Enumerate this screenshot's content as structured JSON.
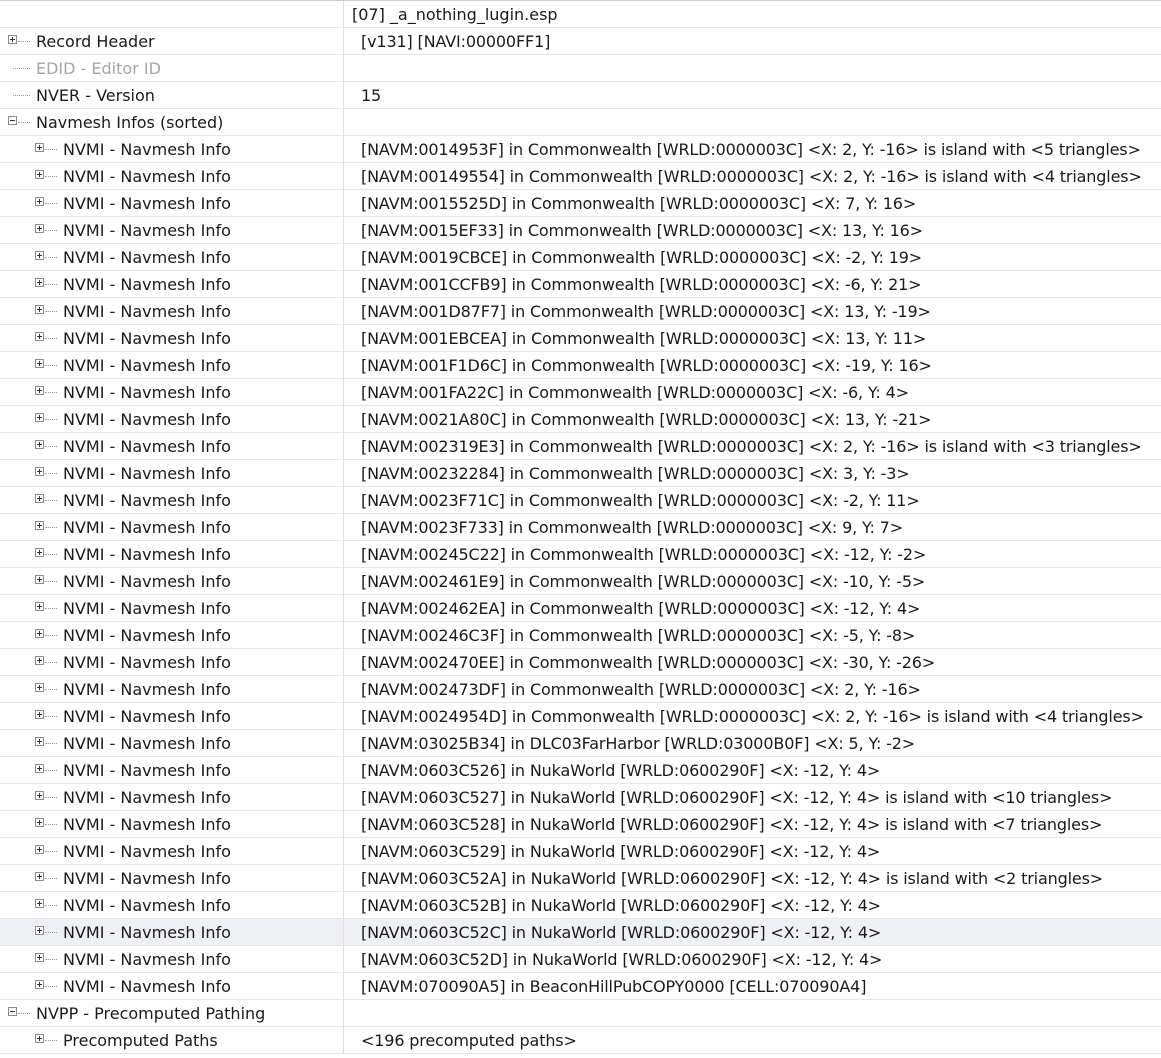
{
  "file_header": "[07] _a_nothing_lugin.esp",
  "record_header": {
    "label": "Record Header",
    "value": "[v131] [NAVI:00000FF1]"
  },
  "edid": {
    "label": "EDID - Editor ID",
    "value": ""
  },
  "nver": {
    "label": "NVER - Version",
    "value": "15"
  },
  "navmesh_infos": {
    "label": "Navmesh Infos (sorted)",
    "item_label": "NVMI - Navmesh Info",
    "items": [
      "[NAVM:0014953F] in Commonwealth [WRLD:0000003C] <X: 2, Y: -16> is island with <5 triangles>",
      "[NAVM:00149554] in Commonwealth [WRLD:0000003C] <X: 2, Y: -16> is island with <4 triangles>",
      "[NAVM:0015525D] in Commonwealth [WRLD:0000003C] <X: 7, Y: 16>",
      "[NAVM:0015EF33] in Commonwealth [WRLD:0000003C] <X: 13, Y: 16>",
      "[NAVM:0019CBCE] in Commonwealth [WRLD:0000003C] <X: -2, Y: 19>",
      "[NAVM:001CCFB9] in Commonwealth [WRLD:0000003C] <X: -6, Y: 21>",
      "[NAVM:001D87F7] in Commonwealth [WRLD:0000003C] <X: 13, Y: -19>",
      "[NAVM:001EBCEA] in Commonwealth [WRLD:0000003C] <X: 13, Y: 11>",
      "[NAVM:001F1D6C] in Commonwealth [WRLD:0000003C] <X: -19, Y: 16>",
      "[NAVM:001FA22C] in Commonwealth [WRLD:0000003C] <X: -6, Y: 4>",
      "[NAVM:0021A80C] in Commonwealth [WRLD:0000003C] <X: 13, Y: -21>",
      "[NAVM:002319E3] in Commonwealth [WRLD:0000003C] <X: 2, Y: -16> is island with <3 triangles>",
      "[NAVM:00232284] in Commonwealth [WRLD:0000003C] <X: 3, Y: -3>",
      "[NAVM:0023F71C] in Commonwealth [WRLD:0000003C] <X: -2, Y: 11>",
      "[NAVM:0023F733] in Commonwealth [WRLD:0000003C] <X: 9, Y: 7>",
      "[NAVM:00245C22] in Commonwealth [WRLD:0000003C] <X: -12, Y: -2>",
      "[NAVM:002461E9] in Commonwealth [WRLD:0000003C] <X: -10, Y: -5>",
      "[NAVM:002462EA] in Commonwealth [WRLD:0000003C] <X: -12, Y: 4>",
      "[NAVM:00246C3F] in Commonwealth [WRLD:0000003C] <X: -5, Y: -8>",
      "[NAVM:002470EE] in Commonwealth [WRLD:0000003C] <X: -30, Y: -26>",
      "[NAVM:002473DF] in Commonwealth [WRLD:0000003C] <X: 2, Y: -16>",
      "[NAVM:0024954D] in Commonwealth [WRLD:0000003C] <X: 2, Y: -16> is island with <4 triangles>",
      "[NAVM:03025B34] in DLC03FarHarbor [WRLD:03000B0F] <X: 5, Y: -2>",
      "[NAVM:0603C526] in NukaWorld [WRLD:0600290F] <X: -12, Y: 4>",
      "[NAVM:0603C527] in NukaWorld [WRLD:0600290F] <X: -12, Y: 4> is island with <10 triangles>",
      "[NAVM:0603C528] in NukaWorld [WRLD:0600290F] <X: -12, Y: 4> is island with <7 triangles>",
      "[NAVM:0603C529] in NukaWorld [WRLD:0600290F] <X: -12, Y: 4>",
      "[NAVM:0603C52A] in NukaWorld [WRLD:0600290F] <X: -12, Y: 4> is island with <2 triangles>",
      "[NAVM:0603C52B] in NukaWorld [WRLD:0600290F] <X: -12, Y: 4>",
      "[NAVM:0603C52C] in NukaWorld [WRLD:0600290F] <X: -12, Y: 4>",
      "[NAVM:0603C52D] in NukaWorld [WRLD:0600290F] <X: -12, Y: 4>",
      "[NAVM:070090A5] in BeaconHillPubCOPY0000 [CELL:070090A4]"
    ]
  },
  "nvpp": {
    "label": "NVPP - Precomputed Pathing",
    "child_label": "Precomputed Paths",
    "child_value": "<196 precomputed paths>"
  },
  "colors": {
    "selected_row": "#eef0f4",
    "disabled_text": "#a6a6a6",
    "grid": "#e6e6e6"
  },
  "icons": {
    "expand": "plus-box-icon",
    "collapse": "minus-box-icon"
  }
}
